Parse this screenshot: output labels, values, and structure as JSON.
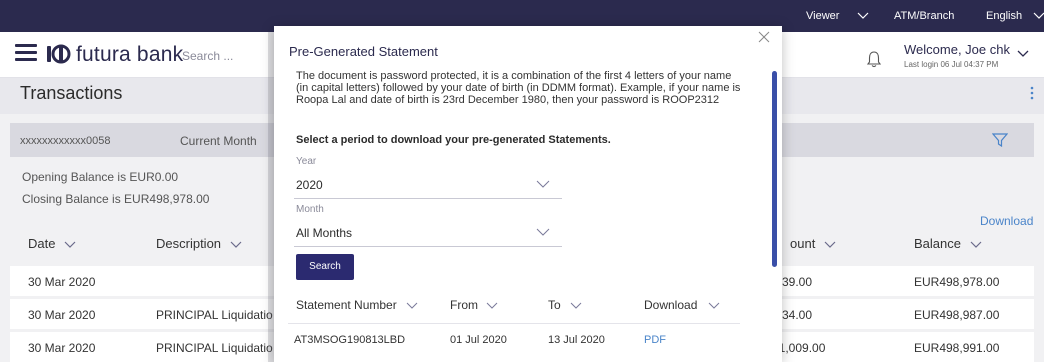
{
  "topbar": {
    "role": "Viewer",
    "location": "ATM/Branch",
    "language": "English"
  },
  "header": {
    "brand": "futura bank",
    "search_placeholder": "Search ...",
    "welcome": "Welcome, Joe chk",
    "last_login": "Last login 06 Jul 04:37 PM"
  },
  "page": {
    "title": "Transactions"
  },
  "filter": {
    "account": "xxxxxxxxxxxx0058",
    "period": "Current Month"
  },
  "balances": {
    "opening": "Opening Balance is EUR0.00",
    "closing": "Closing Balance is EUR498,978.00"
  },
  "download_label": "Download",
  "table": {
    "headers": {
      "date": "Date",
      "description": "Description",
      "amount": "ount",
      "balance": "Balance"
    },
    "rows": [
      {
        "date": "30 Mar 2020",
        "description": "",
        "amount": "39.00",
        "balance": "EUR498,978.00"
      },
      {
        "date": "30 Mar 2020",
        "description": "PRINCIPAL Liquidatio",
        "amount": "34.00",
        "balance": "EUR498,987.00"
      },
      {
        "date": "30 Mar 2020",
        "description": "PRINCIPAL Liquidatio",
        "amount": "31,009.00",
        "balance": "EUR498,991.00"
      }
    ]
  },
  "modal": {
    "title": "Pre-Generated Statement",
    "description": "The document is password protected, it is a combination of the first 4 letters of your name (in capital letters) followed by your date of birth (in DDMM format). Example, if your name is Roopa Lal and date of birth is 23rd December 1980, then your password is ROOP2312",
    "select_label": "Select a period to download your pre-generated Statements.",
    "year_label": "Year",
    "year_value": "2020",
    "month_label": "Month",
    "month_value": "All Months",
    "search_button": "Search",
    "columns": {
      "statement_number": "Statement Number",
      "from": "From",
      "to": "To",
      "download": "Download"
    },
    "rows": [
      {
        "statement_number": "AT3MSOG190813LBD",
        "from": "01 Jul 2020",
        "to": "13 Jul 2020",
        "download": "PDF"
      }
    ]
  },
  "colors": {
    "topbar": "#2b2a4e",
    "primary_button": "#2b2a70",
    "link": "#4a84c9",
    "scrollbar": "#3a4fa8"
  },
  "icons": [
    "hamburger-icon",
    "logo-icon",
    "bell-icon",
    "chevron-down-icon",
    "kebab-icon",
    "filter-icon",
    "close-icon"
  ]
}
